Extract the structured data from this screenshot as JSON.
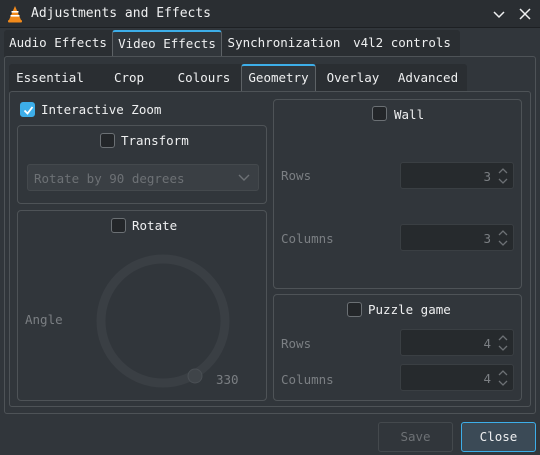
{
  "window": {
    "title": "Adjustments and Effects",
    "minimize_icon": "chevron-down-icon",
    "close_icon": "close-icon"
  },
  "main_tabs": [
    {
      "label": "Audio Effects",
      "active": false
    },
    {
      "label": "Video Effects",
      "active": true
    },
    {
      "label": "Synchronization",
      "active": false
    },
    {
      "label": "v4l2 controls",
      "active": false
    }
  ],
  "sub_tabs": [
    {
      "label": "Essential",
      "active": false
    },
    {
      "label": "Crop",
      "active": false
    },
    {
      "label": "Colours",
      "active": false
    },
    {
      "label": "Geometry",
      "active": true
    },
    {
      "label": "Overlay",
      "active": false
    },
    {
      "label": "Advanced",
      "active": false
    }
  ],
  "geometry": {
    "interactive_zoom": {
      "label": "Interactive Zoom",
      "checked": true
    },
    "transform": {
      "label": "Transform",
      "checked": false,
      "select_value": "Rotate by 90 degrees"
    },
    "rotate": {
      "label": "Rotate",
      "checked": false,
      "angle_label": "Angle",
      "angle_value": "330"
    },
    "wall": {
      "label": "Wall",
      "checked": false,
      "rows_label": "Rows",
      "rows_value": "3",
      "columns_label": "Columns",
      "columns_value": "3"
    },
    "puzzle": {
      "label": "Puzzle game",
      "checked": false,
      "rows_label": "Rows",
      "rows_value": "4",
      "columns_label": "Columns",
      "columns_value": "4"
    }
  },
  "buttons": {
    "save": "Save",
    "close": "Close"
  },
  "colors": {
    "accent": "#3daee9",
    "background": "#31363b",
    "text": "#eff0f1",
    "disabled_text": "#7b7f83"
  }
}
